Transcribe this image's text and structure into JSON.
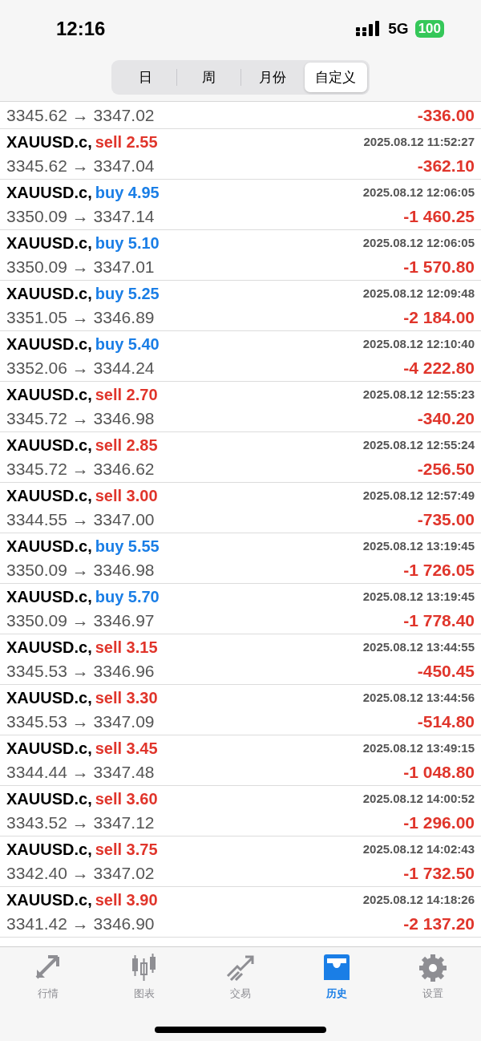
{
  "status_bar": {
    "time": "12:16",
    "network": "5G",
    "battery": "100"
  },
  "segments": [
    {
      "label": "日",
      "selected": false
    },
    {
      "label": "周",
      "selected": false
    },
    {
      "label": "月份",
      "selected": false
    },
    {
      "label": "自定义",
      "selected": true
    }
  ],
  "first_row": {
    "prices": "3345.62 → 3347.02",
    "profit": "-336.00"
  },
  "deals": [
    {
      "symbol": "XAUUSD.c,",
      "side": "sell",
      "volume": "2.55",
      "time": "2025.08.12 11:52:27",
      "prices": "3345.62 → 3347.04",
      "profit": "-362.10"
    },
    {
      "symbol": "XAUUSD.c,",
      "side": "buy",
      "volume": "4.95",
      "time": "2025.08.12 12:06:05",
      "prices": "3350.09 → 3347.14",
      "profit": "-1 460.25"
    },
    {
      "symbol": "XAUUSD.c,",
      "side": "buy",
      "volume": "5.10",
      "time": "2025.08.12 12:06:05",
      "prices": "3350.09 → 3347.01",
      "profit": "-1 570.80"
    },
    {
      "symbol": "XAUUSD.c,",
      "side": "buy",
      "volume": "5.25",
      "time": "2025.08.12 12:09:48",
      "prices": "3351.05 → 3346.89",
      "profit": "-2 184.00"
    },
    {
      "symbol": "XAUUSD.c,",
      "side": "buy",
      "volume": "5.40",
      "time": "2025.08.12 12:10:40",
      "prices": "3352.06 → 3344.24",
      "profit": "-4 222.80"
    },
    {
      "symbol": "XAUUSD.c,",
      "side": "sell",
      "volume": "2.70",
      "time": "2025.08.12 12:55:23",
      "prices": "3345.72 → 3346.98",
      "profit": "-340.20"
    },
    {
      "symbol": "XAUUSD.c,",
      "side": "sell",
      "volume": "2.85",
      "time": "2025.08.12 12:55:24",
      "prices": "3345.72 → 3346.62",
      "profit": "-256.50"
    },
    {
      "symbol": "XAUUSD.c,",
      "side": "sell",
      "volume": "3.00",
      "time": "2025.08.12 12:57:49",
      "prices": "3344.55 → 3347.00",
      "profit": "-735.00"
    },
    {
      "symbol": "XAUUSD.c,",
      "side": "buy",
      "volume": "5.55",
      "time": "2025.08.12 13:19:45",
      "prices": "3350.09 → 3346.98",
      "profit": "-1 726.05"
    },
    {
      "symbol": "XAUUSD.c,",
      "side": "buy",
      "volume": "5.70",
      "time": "2025.08.12 13:19:45",
      "prices": "3350.09 → 3346.97",
      "profit": "-1 778.40"
    },
    {
      "symbol": "XAUUSD.c,",
      "side": "sell",
      "volume": "3.15",
      "time": "2025.08.12 13:44:55",
      "prices": "3345.53 → 3346.96",
      "profit": "-450.45"
    },
    {
      "symbol": "XAUUSD.c,",
      "side": "sell",
      "volume": "3.30",
      "time": "2025.08.12 13:44:56",
      "prices": "3345.53 → 3347.09",
      "profit": "-514.80"
    },
    {
      "symbol": "XAUUSD.c,",
      "side": "sell",
      "volume": "3.45",
      "time": "2025.08.12 13:49:15",
      "prices": "3344.44 → 3347.48",
      "profit": "-1 048.80"
    },
    {
      "symbol": "XAUUSD.c,",
      "side": "sell",
      "volume": "3.60",
      "time": "2025.08.12 14:00:52",
      "prices": "3343.52 → 3347.12",
      "profit": "-1 296.00"
    },
    {
      "symbol": "XAUUSD.c,",
      "side": "sell",
      "volume": "3.75",
      "time": "2025.08.12 14:02:43",
      "prices": "3342.40 → 3347.02",
      "profit": "-1 732.50"
    },
    {
      "symbol": "XAUUSD.c,",
      "side": "sell",
      "volume": "3.90",
      "time": "2025.08.12 14:18:26",
      "prices": "3341.42 → 3346.90",
      "profit": "-2 137.20"
    }
  ],
  "tab_bar": [
    {
      "kind": "quotes",
      "label": "行情",
      "selected": false
    },
    {
      "kind": "chart",
      "label": "图表",
      "selected": false
    },
    {
      "kind": "trade",
      "label": "交易",
      "selected": false
    },
    {
      "kind": "history",
      "label": "历史",
      "selected": true
    },
    {
      "kind": "settings",
      "label": "设置",
      "selected": false
    }
  ]
}
